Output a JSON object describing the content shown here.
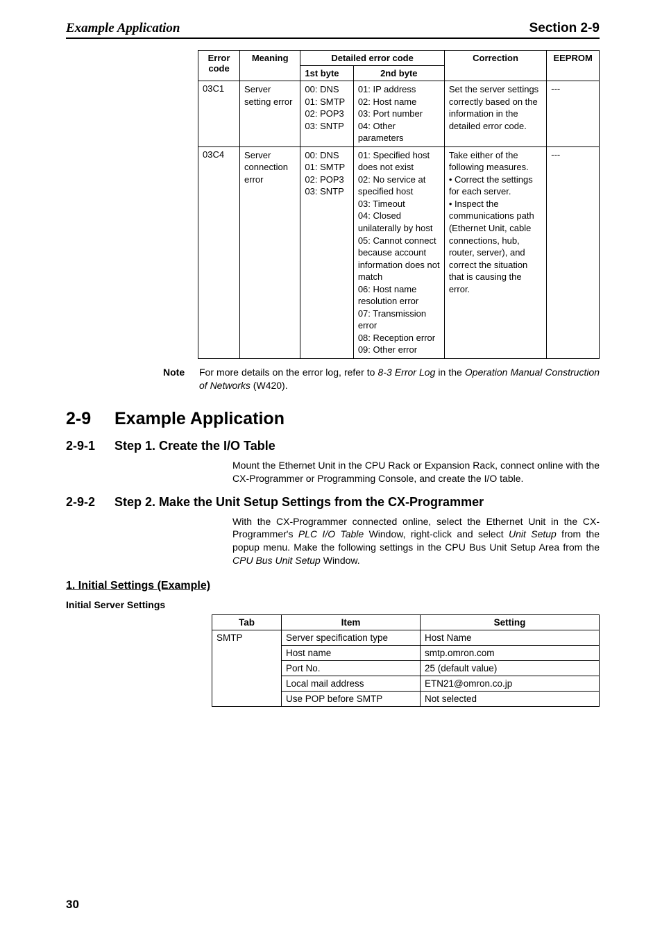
{
  "header": {
    "left": "Example Application",
    "right": "Section 2-9"
  },
  "errorTable": {
    "head": {
      "error": "Error code",
      "meaning": "Meaning",
      "detailed": "Detailed error code",
      "byte1": "1st byte",
      "byte2": "2nd byte",
      "correction": "Correction",
      "eeprom": "EEPROM"
    },
    "rows": [
      {
        "code": "03C1",
        "meaning": "Server setting error",
        "byte1": "00: DNS\n01: SMTP\n02: POP3\n03: SNTP",
        "byte2": "01: IP address\n02: Host name\n03: Port number\n04: Other parameters",
        "correction": "Set the server settings correctly based on the information in the detailed error code.",
        "eeprom": "---"
      },
      {
        "code": "03C4",
        "meaning": "Server connection error",
        "byte1": "00: DNS\n01: SMTP\n02: POP3\n03: SNTP",
        "byte2": "01: Specified host does not exist\n02: No service at specified host\n03: Timeout\n04: Closed unilaterally by host\n05: Cannot connect because account information does not match\n06: Host name resolution error\n07: Transmission error\n08: Reception error\n09: Other error",
        "correction": "Take either of the following measures.\n• Correct the settings for each server.\n• Inspect the communications path (Ethernet Unit, cable connections, hub, router, server), and correct the situation that is causing the error.",
        "eeprom": "---"
      }
    ]
  },
  "note": {
    "label": "Note",
    "textPrefix": "For more details on the error log, refer to ",
    "textItalic1": "8-3 Error Log",
    "textMid": " in the ",
    "textItalic2": "Operation Manual Construction of Networks",
    "textSuffix": " (W420)."
  },
  "sections": {
    "main": {
      "num": "2-9",
      "title": "Example Application"
    },
    "sub1": {
      "num": "2-9-1",
      "title": "Step 1. Create the I/O Table",
      "body": "Mount the Ethernet Unit in the CPU Rack or Expansion Rack, connect online with the CX-Programmer or Programming Console, and create the I/O table."
    },
    "sub2": {
      "num": "2-9-2",
      "title": "Step 2. Make the Unit Setup Settings from the CX-Programmer",
      "body1": "With the CX-Programmer connected online, select the Ethernet Unit in the CX-Programmer's ",
      "bodyItalic1": "PLC I/O Table",
      "body2": " Window, right-click and select ",
      "bodyItalic2": "Unit Setup",
      "body3": " from the popup menu. Make the following settings in the CPU Bus Unit Setup Area from the ",
      "bodyItalic3": "CPU Bus Unit Setup",
      "body4": " Window."
    }
  },
  "settings": {
    "heading": "1. Initial Settings (Example)",
    "subheading": "Initial Server Settings",
    "head": {
      "tab": "Tab",
      "item": "Item",
      "setting": "Setting"
    },
    "rows": [
      {
        "tab": "SMTP",
        "item": "Server specification type",
        "setting": "Host Name"
      },
      {
        "item": "Host name",
        "setting": "smtp.omron.com"
      },
      {
        "item": "Port No.",
        "setting": "25 (default value)"
      },
      {
        "item": "Local mail address",
        "setting": "ETN21@omron.co.jp"
      },
      {
        "item": "Use POP before SMTP",
        "setting": "Not selected"
      }
    ]
  },
  "pageNumber": "30"
}
